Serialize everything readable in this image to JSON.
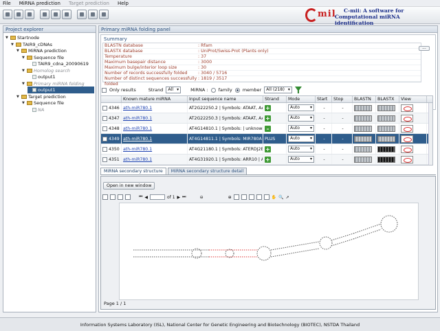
{
  "menu": [
    {
      "label": "File",
      "enabled": true
    },
    {
      "label": "MiRNA prediction",
      "enabled": true
    },
    {
      "label": "Target prediction",
      "enabled": false
    },
    {
      "label": "Help",
      "enabled": true
    }
  ],
  "logo": {
    "mark": "mil",
    "tagline1": "C-mii: A software for",
    "tagline2": "Computational miRNA identification"
  },
  "explorer": {
    "title": "Project explorer",
    "nodes": [
      {
        "label": "Startnode",
        "state": "normal"
      },
      {
        "label": "TAIR9_cDNAs",
        "state": "normal"
      },
      {
        "label": "MiRNA prediction",
        "state": "normal"
      },
      {
        "label": "Sequence file",
        "state": "normal"
      },
      {
        "label": "TAIR9_cdna_20090619",
        "state": "normal"
      },
      {
        "label": "Homolog search",
        "state": "dim"
      },
      {
        "label": "output1",
        "state": "normal"
      },
      {
        "label": "Primary miRNA folding",
        "state": "dim"
      },
      {
        "label": "output1",
        "state": "selected"
      },
      {
        "label": "Target prediction",
        "state": "normal"
      },
      {
        "label": "Sequence file",
        "state": "normal"
      },
      {
        "label": "NA",
        "state": "dim"
      }
    ]
  },
  "panel": {
    "title": "Primary miRNA folding panel"
  },
  "summary": {
    "title": "Summary",
    "rows": [
      {
        "k": "BLASTN database",
        "v": ": Rfam"
      },
      {
        "k": "BLASTX database",
        "v": ": UniProt/Swiss-Prot (Plants only)"
      },
      {
        "k": "Temperature",
        "v": ": 37"
      },
      {
        "k": "Maximum basepair distance",
        "v": ": 3000"
      },
      {
        "k": "Maximum bulge/interior loop size",
        "v": ": 30"
      },
      {
        "k": "Number of records successfully folded",
        "v": ": 3040 / 5716"
      },
      {
        "k": "Number of distinct sequences successfully folded",
        "v": ": 1819 / 3517"
      }
    ],
    "button": "..."
  },
  "filter": {
    "only_results": "Only results",
    "strand_label": "Strand",
    "strand_value": "All",
    "mirna_label": "MiRNA :",
    "family": "family",
    "member": "member",
    "member_value": "All (218)"
  },
  "grid": {
    "columns": [
      "",
      "Known mature miRNA",
      "Input sequence name",
      "Strand",
      "Mode",
      "Start",
      "Stop",
      "BLASTN",
      "BLASTX",
      "View"
    ],
    "rows": [
      {
        "id": "4346",
        "mirna": "ath-miR780.1",
        "seq": "AT2G22250.2 | Symbols: ATAAT, AAT,...",
        "strand": "+",
        "mode": "Auto",
        "start": "-",
        "stop": "-",
        "selected": false,
        "alt": false
      },
      {
        "id": "4347",
        "mirna": "ath-miR780.1",
        "seq": "AT2G22250.3 | Symbols: ATAAT, AAT,...",
        "strand": "+",
        "mode": "Auto",
        "start": "-",
        "stop": "-",
        "selected": false,
        "alt": true
      },
      {
        "id": "4348",
        "mirna": "ath-miR780.1",
        "seq": "AT4G14810.1 | Symbols: | unknown ...",
        "strand": "–",
        "mode": "Auto",
        "start": "-",
        "stop": "-",
        "selected": false,
        "alt": false
      },
      {
        "id": "4349",
        "mirna": "ath-miR780.1",
        "seq": "AT4G14811.1 | Symbols: MIR780A | M...",
        "strand": "PLUS",
        "mode": "Auto",
        "start": "-",
        "stop": "-",
        "selected": true,
        "alt": false
      },
      {
        "id": "4350",
        "mirna": "ath-miR780.1",
        "seq": "AT4G21180.1 | Symbols: ATERDJ2B |...",
        "strand": "+",
        "mode": "Auto",
        "start": "-",
        "stop": "-",
        "selected": false,
        "alt": false
      },
      {
        "id": "4351",
        "mirna": "ath-miR780.1",
        "seq": "AT4G31920.1 | Symbols: ARR10 | AR...",
        "strand": "+",
        "mode": "Auto",
        "start": "-",
        "stop": "-",
        "selected": false,
        "alt": true
      }
    ]
  },
  "tabs": [
    {
      "label": "MiRNA secondary structure",
      "active": true
    },
    {
      "label": "MiRNA secondary structure detail",
      "active": false
    }
  ],
  "viewer": {
    "open_button": "Open in new window",
    "page_of": "of 1",
    "page_label": "Page 1 / 1"
  },
  "status": "Information Systems Laboratory (ISL), National Center for Genetic Engineering and Biotechnology (BIOTEC), NSTDA Thailand"
}
